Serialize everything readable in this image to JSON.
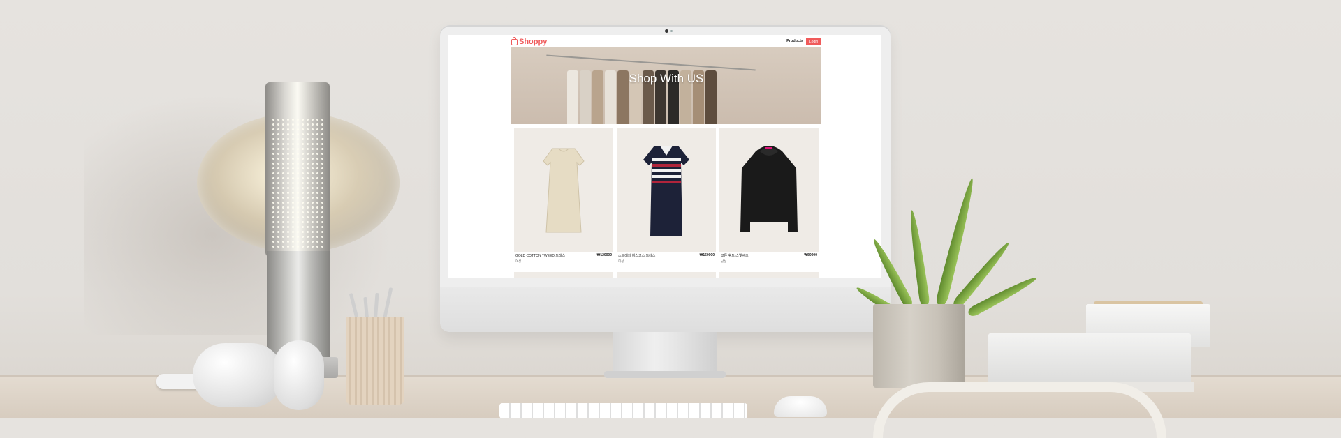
{
  "site": {
    "logo_text": "Shoppy",
    "nav": {
      "products_label": "Products",
      "login_label": "Login"
    },
    "banner_title": "Shop With US"
  },
  "products": [
    {
      "name": "GOLD COTTON TWEED 드레스",
      "price": "₩120000",
      "category": "여성"
    },
    {
      "name": "스트레치 비스코스 드레스",
      "price": "₩150000",
      "category": "여성"
    },
    {
      "name": "코튼 후드 스웻셔츠",
      "price": "₩50000",
      "category": "남성"
    }
  ],
  "colors": {
    "brand": "#f05a5a",
    "card_bg": "#efebe6"
  }
}
